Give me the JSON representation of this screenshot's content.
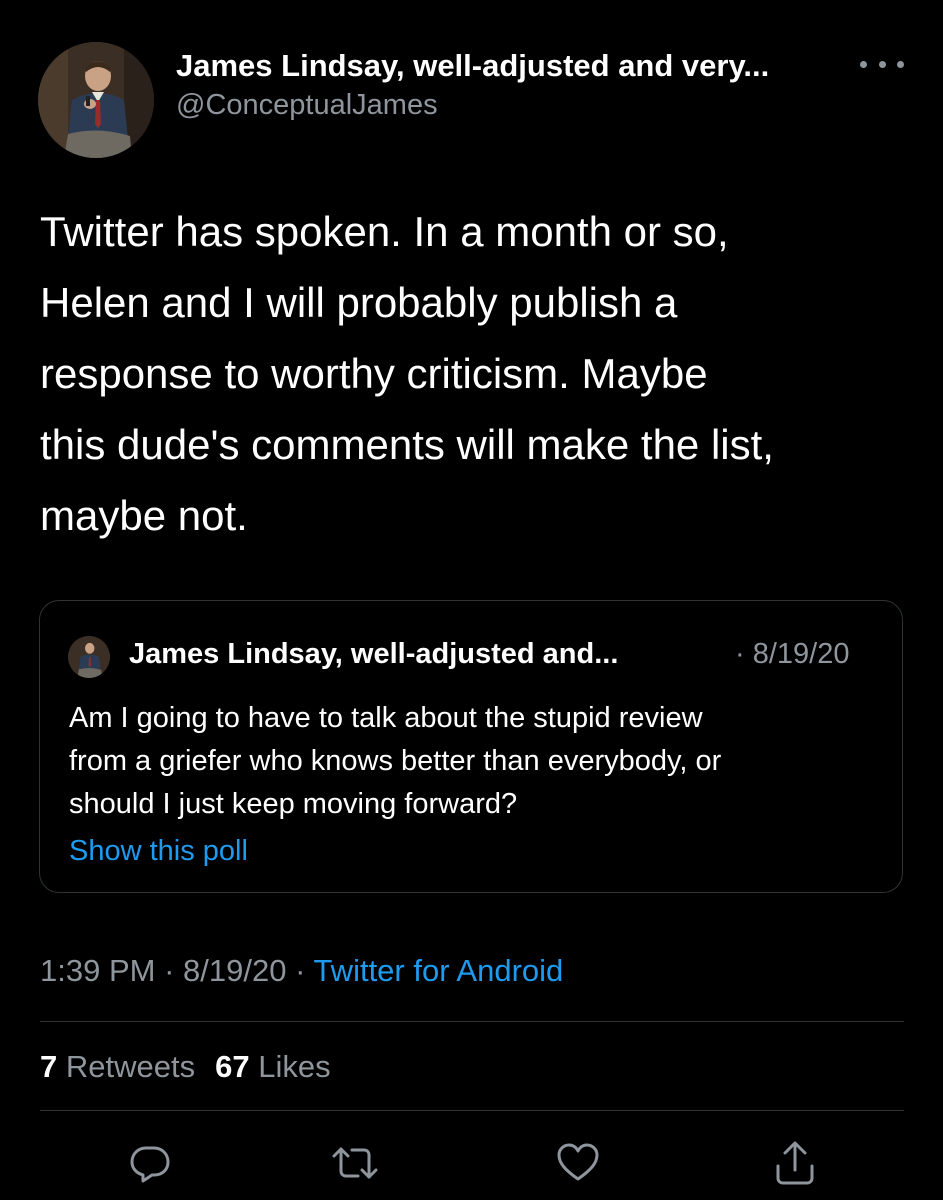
{
  "tweet": {
    "author_name": "James Lindsay, well-adjusted and very...",
    "author_handle": "@ConceptualJames",
    "text_lines": [
      "Twitter has spoken. In a month or so,",
      "Helen and I will probably publish a",
      "response to worthy criticism. Maybe",
      "this dude's comments will make the list,",
      "maybe not."
    ],
    "time": "1:39 PM",
    "date": "8/19/20",
    "source": "Twitter for Android",
    "separator": " · "
  },
  "quoted_tweet": {
    "author_name": "James Lindsay, well-adjusted and...",
    "date": "· 8/19/20",
    "text_lines": [
      "Am I going to have to talk about the stupid review",
      "from a griefer who knows better than everybody, or",
      "should I just keep moving forward?"
    ],
    "show_poll_label": "Show this poll"
  },
  "stats": {
    "retweets_count": "7",
    "retweets_label": "Retweets",
    "likes_count": "67",
    "likes_label": "Likes"
  },
  "icons": {
    "more": "more-horizontal-icon",
    "reply": "reply-icon",
    "retweet": "retweet-icon",
    "like": "heart-icon",
    "share": "share-icon"
  },
  "colors": {
    "background": "#000000",
    "text_primary": "#ffffff",
    "text_secondary": "#8e959c",
    "link": "#1d9bf0",
    "border": "#2f3336"
  }
}
